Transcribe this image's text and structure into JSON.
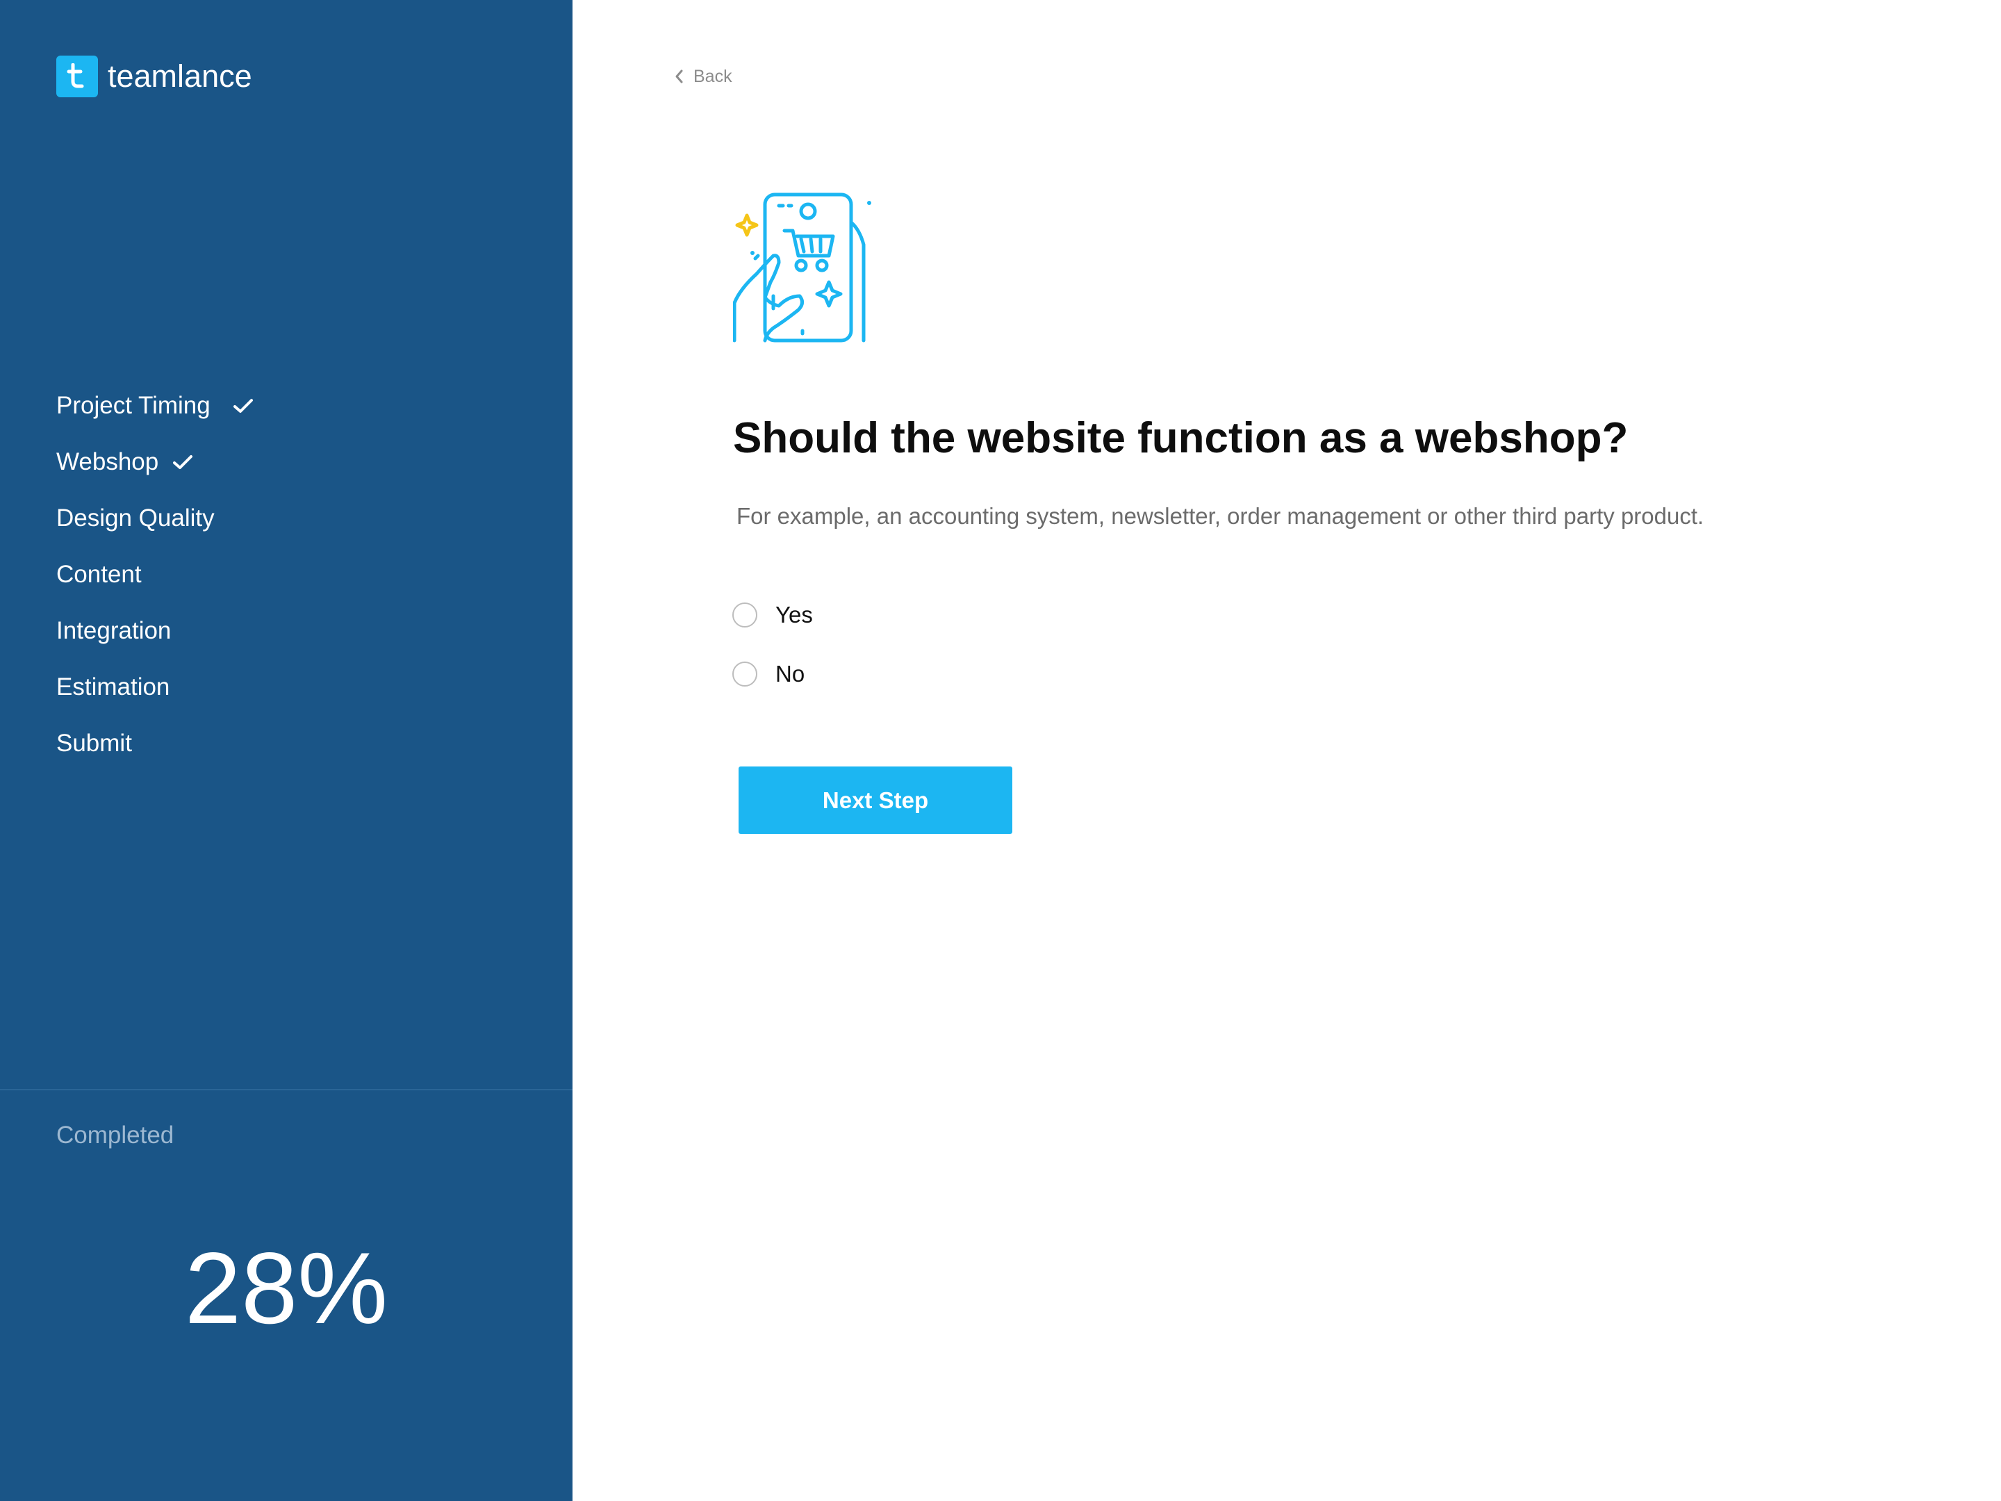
{
  "brand": {
    "name": "teamlance",
    "accent": "#1cb6f2",
    "sidebar_bg": "#1a5587"
  },
  "sidebar": {
    "steps": [
      {
        "label": "Project Timing",
        "done": true
      },
      {
        "label": "Webshop",
        "done": true
      },
      {
        "label": "Design Quality",
        "done": false
      },
      {
        "label": "Content",
        "done": false
      },
      {
        "label": "Integration",
        "done": false
      },
      {
        "label": "Estimation",
        "done": false
      },
      {
        "label": "Submit",
        "done": false
      }
    ],
    "completed_label": "Completed",
    "progress_text": "28%",
    "progress_value": 28
  },
  "main": {
    "back_label": "Back",
    "illustration_icon": "mobile-shopping-icon",
    "question": "Should the website function as a webshop?",
    "hint": "For example, an accounting system, newsletter, order management or other third party product.",
    "options": [
      "Yes",
      "No"
    ],
    "next_label": "Next Step"
  }
}
